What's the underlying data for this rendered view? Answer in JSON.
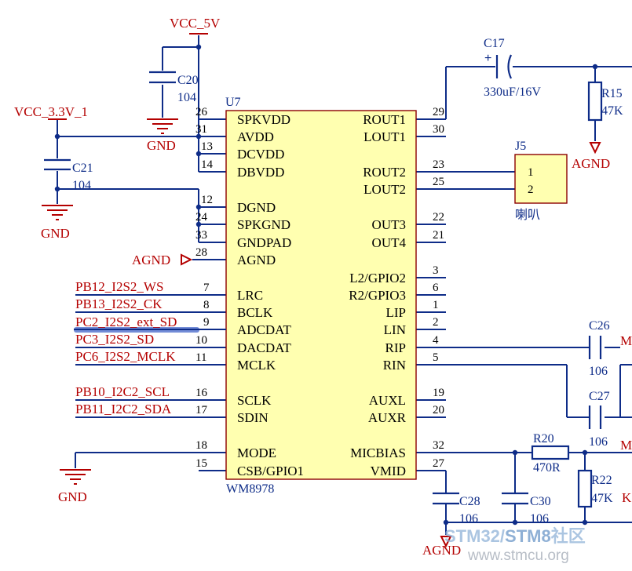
{
  "ic": {
    "ref": "U7",
    "part": "WM8978",
    "left_pins": [
      {
        "num": "26",
        "name": "SPKVDD"
      },
      {
        "num": "31",
        "name": "AVDD"
      },
      {
        "num": "13",
        "name": "DCVDD"
      },
      {
        "num": "14",
        "name": "DBVDD"
      },
      {
        "num": "12",
        "name": "DGND"
      },
      {
        "num": "24",
        "name": "SPKGND"
      },
      {
        "num": "33",
        "name": "GNDPAD"
      },
      {
        "num": "28",
        "name": "AGND"
      },
      {
        "num": "7",
        "name": "LRC"
      },
      {
        "num": "8",
        "name": "BCLK"
      },
      {
        "num": "9",
        "name": "ADCDAT"
      },
      {
        "num": "10",
        "name": "DACDAT"
      },
      {
        "num": "11",
        "name": "MCLK"
      },
      {
        "num": "16",
        "name": "SCLK"
      },
      {
        "num": "17",
        "name": "SDIN"
      },
      {
        "num": "18",
        "name": "MODE"
      },
      {
        "num": "15",
        "name": "CSB/GPIO1"
      }
    ],
    "right_pins": [
      {
        "num": "29",
        "name": "ROUT1"
      },
      {
        "num": "30",
        "name": "LOUT1"
      },
      {
        "num": "23",
        "name": "ROUT2"
      },
      {
        "num": "25",
        "name": "LOUT2"
      },
      {
        "num": "22",
        "name": "OUT3"
      },
      {
        "num": "21",
        "name": "OUT4"
      },
      {
        "num": "3",
        "name": "L2/GPIO2"
      },
      {
        "num": "6",
        "name": "R2/GPIO3"
      },
      {
        "num": "1",
        "name": "LIP"
      },
      {
        "num": "2",
        "name": "LIN"
      },
      {
        "num": "4",
        "name": "RIP"
      },
      {
        "num": "5",
        "name": "RIN"
      },
      {
        "num": "19",
        "name": "AUXL"
      },
      {
        "num": "20",
        "name": "AUXR"
      },
      {
        "num": "32",
        "name": "MICBIAS"
      },
      {
        "num": "27",
        "name": "VMID"
      }
    ]
  },
  "nets": {
    "vcc5": "VCC_5V",
    "vcc33": "VCC_3.3V_1",
    "gnd": "GND",
    "agnd": "AGND",
    "m_partial": "M",
    "k_partial": "K",
    "signals": [
      "PB12_I2S2_WS",
      "PB13_I2S2_CK",
      "PC2_I2S2_ext_SD",
      "PC3_I2S2_SD",
      "PC6_I2S2_MCLK",
      "PB10_I2C2_SCL",
      "PB11_I2C2_SDA"
    ]
  },
  "parts": {
    "c20": {
      "ref": "C20",
      "value": "104"
    },
    "c21": {
      "ref": "C21",
      "value": "104"
    },
    "c17": {
      "ref": "C17",
      "value": "330uF/16V",
      "polarity": "+"
    },
    "r15": {
      "ref": "R15",
      "value": "47K"
    },
    "j5": {
      "ref": "J5",
      "pin1": "1",
      "pin2": "2",
      "label": "喇叭"
    },
    "c26": {
      "ref": "C26",
      "value": "106"
    },
    "c27": {
      "ref": "C27",
      "value": "106"
    },
    "r20": {
      "ref": "R20",
      "value": "470R"
    },
    "r22": {
      "ref": "R22",
      "value": "47K"
    },
    "c28": {
      "ref": "C28",
      "value": "106"
    },
    "c30": {
      "ref": "C30",
      "value": "106"
    }
  },
  "watermark": {
    "line1a": "STM32/",
    "line1b": "STM8",
    "line1c": "社区",
    "line2": "www.stmcu.org"
  },
  "colors": {
    "wire": "#0e2c88",
    "net": "#b40000",
    "ic_fill": "#ffffb0",
    "ic_border": "#8b0000",
    "selection": "#5a78d0"
  }
}
